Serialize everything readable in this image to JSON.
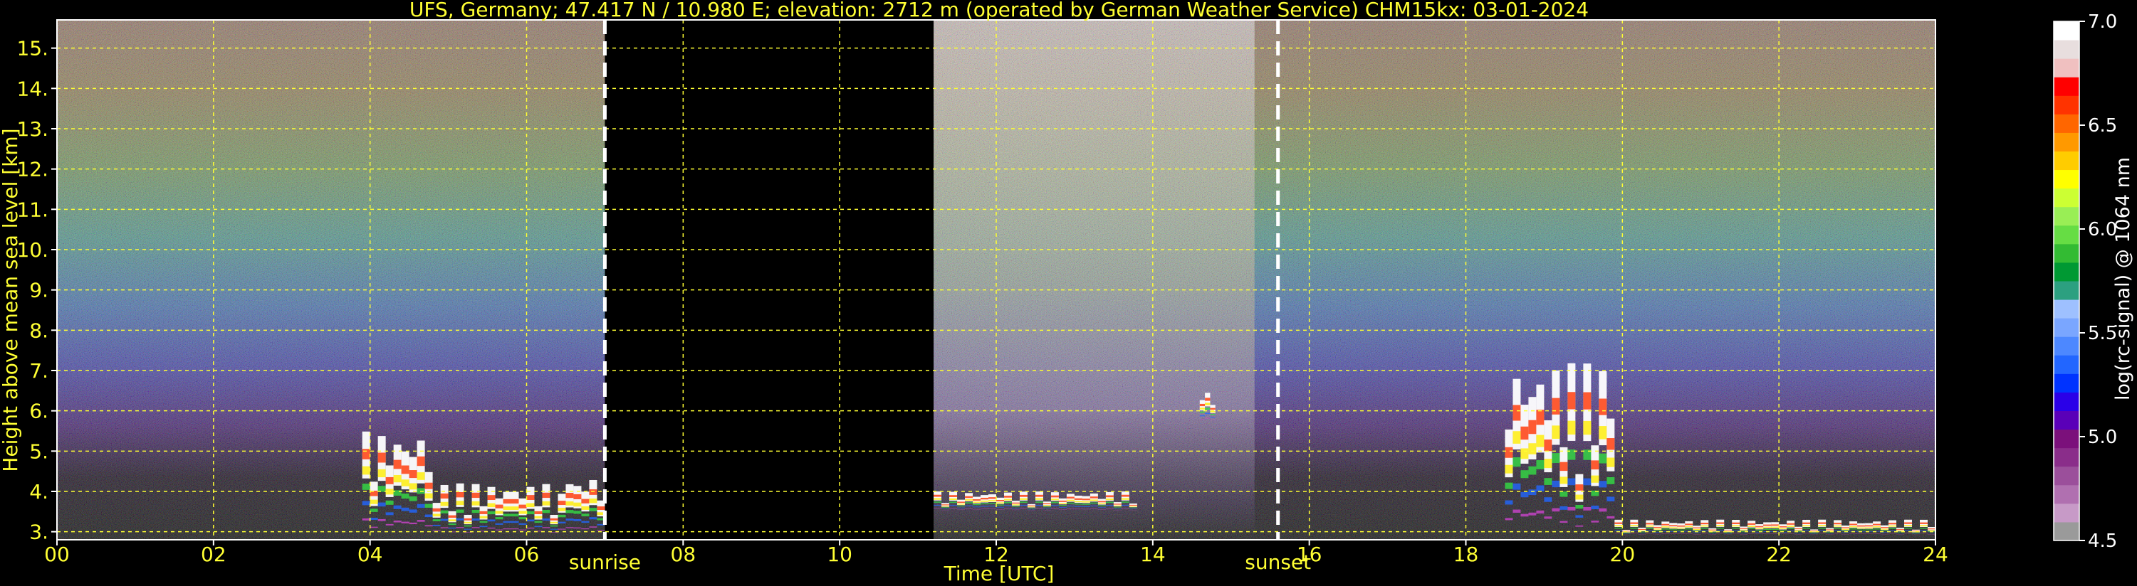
{
  "chart_data": {
    "type": "heatmap",
    "title": "UFS, Germany; 47.417 N / 10.980 E; elevation: 2712 m  (operated by German Weather Service)    CHM15kx: 03-01-2024",
    "xlabel": "Time [UTC]",
    "ylabel": "Height above mean sea level [km]",
    "xlim": [
      0,
      24
    ],
    "ylim": [
      2.8,
      15.7
    ],
    "x_ticks": [
      "00",
      "02",
      "04",
      "06",
      "08",
      "10",
      "12",
      "14",
      "16",
      "18",
      "20",
      "22",
      "24"
    ],
    "y_ticks": [
      "3.",
      "4.",
      "5.",
      "6.",
      "7.",
      "8.",
      "9.",
      "10.",
      "11.",
      "12.",
      "13.",
      "14.",
      "15."
    ],
    "grid": true,
    "no_data_interval": [
      7.0,
      11.2
    ],
    "events": [
      {
        "label": "sunrise",
        "x": 7.0
      },
      {
        "label": "sunset",
        "x": 15.6
      }
    ],
    "colorbar": {
      "label": "log(rc-signal) @ 1064 nm",
      "range": [
        4.5,
        7.0
      ],
      "ticks": [
        "4.5",
        "5.0",
        "5.5",
        "6.0",
        "6.5",
        "7.0"
      ],
      "colors": [
        "#9a9a9a",
        "#c79ac7",
        "#b070b0",
        "#9b4f9b",
        "#8a2d8a",
        "#7b107b",
        "#5a00b8",
        "#2a00e8",
        "#0033ff",
        "#2266ff",
        "#4d88ff",
        "#7aa6ff",
        "#9ec0ff",
        "#2ca080",
        "#009933",
        "#33bb33",
        "#66dd44",
        "#99ee55",
        "#ccff33",
        "#ffff00",
        "#ffcc00",
        "#ff9900",
        "#ff6600",
        "#ff3300",
        "#ff0000",
        "#f0c0c0",
        "#e8dede",
        "#ffffff"
      ]
    },
    "clouds": [
      {
        "start": 3.9,
        "end": 4.8,
        "base": 2.9,
        "top": 5.5
      },
      {
        "start": 4.8,
        "end": 6.4,
        "base": 2.9,
        "top": 4.2
      },
      {
        "start": 6.4,
        "end": 7.0,
        "base": 2.9,
        "top": 4.4
      },
      {
        "start": 11.2,
        "end": 13.8,
        "base": 3.5,
        "top": 4.0
      },
      {
        "start": 14.6,
        "end": 14.8,
        "base": 5.7,
        "top": 6.5
      },
      {
        "start": 18.5,
        "end": 19.9,
        "base": 2.9,
        "top": 7.2
      },
      {
        "start": 19.9,
        "end": 24.0,
        "base": 2.9,
        "top": 3.3
      }
    ]
  }
}
